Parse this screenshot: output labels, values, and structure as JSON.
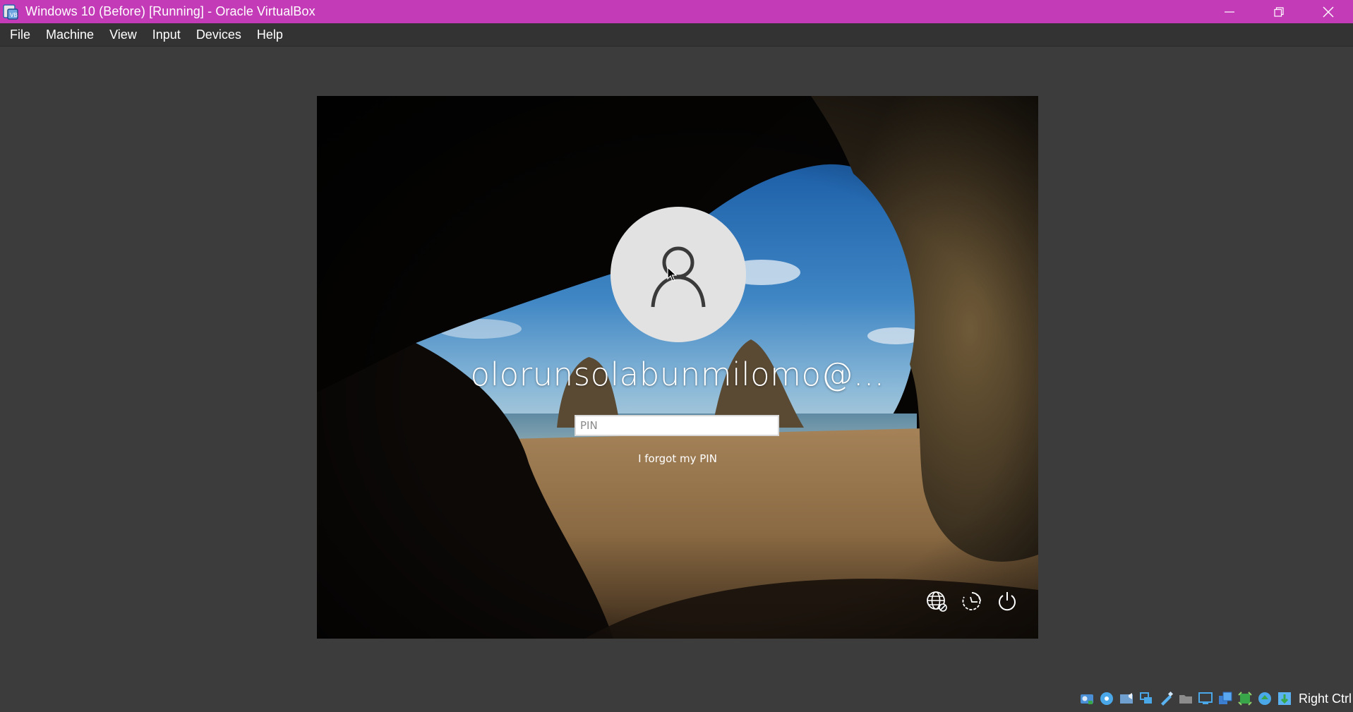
{
  "window": {
    "title": "Windows 10 (Before) [Running] - Oracle VirtualBox",
    "accent_color": "#c43bb8"
  },
  "menubar": {
    "items": [
      {
        "label": "File"
      },
      {
        "label": "Machine"
      },
      {
        "label": "View"
      },
      {
        "label": "Input"
      },
      {
        "label": "Devices"
      },
      {
        "label": "Help"
      }
    ]
  },
  "login": {
    "username": "olorunsolabunmilomo@...",
    "pin_placeholder": "PIN",
    "pin_value": "",
    "forgot_pin_label": "I forgot my PIN",
    "corner_icons": [
      "network-globe-icon",
      "ease-of-access-icon",
      "power-icon"
    ]
  },
  "statusbar": {
    "tray_icons": [
      "hard-disk-icon",
      "optical-drive-icon",
      "audio-icon",
      "network-icon",
      "usb-icon",
      "shared-folders-icon",
      "display-icon",
      "recording-icon",
      "guest-additions-icon",
      "cpu-icon",
      "mouse-integration-icon"
    ],
    "host_key_label": "Right Ctrl"
  }
}
